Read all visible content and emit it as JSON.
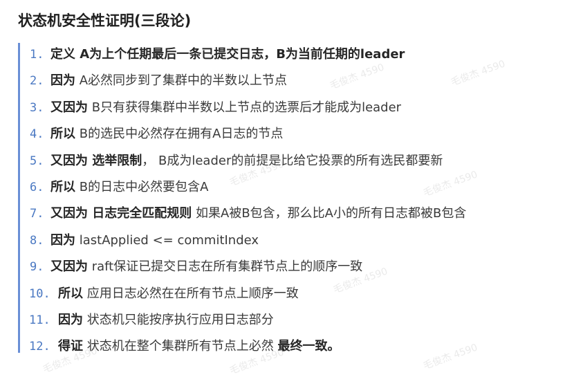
{
  "heading": "状态机安全性证明(三段论)",
  "watermark_text": "毛俊杰 4590",
  "items": [
    {
      "num": "1.",
      "kw": "定义",
      "segments": [
        {
          "t": " A为上个任期最后一条已提交日志，B为当前任期的leader",
          "b": true
        }
      ]
    },
    {
      "num": "2.",
      "kw": "因为",
      "segments": [
        {
          "t": " A必然同步到了集群中的半数以上节点",
          "b": false
        }
      ]
    },
    {
      "num": "3.",
      "kw": "又因为",
      "segments": [
        {
          "t": " B只有获得集群中半数以上节点的选票后才能成为leader",
          "b": false
        }
      ]
    },
    {
      "num": "4.",
      "kw": "所以",
      "segments": [
        {
          "t": " B的选民中必然存在拥有A日志的节点",
          "b": false
        }
      ]
    },
    {
      "num": "5.",
      "kw": "又因为",
      "segments": [
        {
          "t": " 选举限制",
          "b": true
        },
        {
          "t": "， B成为leader的前提是比给它投票的所有选民都要新",
          "b": false
        }
      ]
    },
    {
      "num": "6.",
      "kw": "所以",
      "segments": [
        {
          "t": " B的日志中必然要包含A",
          "b": false
        }
      ]
    },
    {
      "num": "7.",
      "kw": "又因为",
      "segments": [
        {
          "t": " 日志完全匹配规则",
          "b": true
        },
        {
          "t": " 如果A被B包含，那么比A小的所有日志都被B包含",
          "b": false
        }
      ]
    },
    {
      "num": "8.",
      "kw": "因为",
      "segments": [
        {
          "t": " lastApplied <= commitIndex",
          "b": false
        }
      ]
    },
    {
      "num": "9.",
      "kw": "又因为",
      "segments": [
        {
          "t": " raft保证已提交日志在所有集群节点上的顺序一致",
          "b": false
        }
      ]
    },
    {
      "num": "10.",
      "kw": "所以",
      "segments": [
        {
          "t": " 应用日志必然在在所有节点上顺序一致",
          "b": false
        }
      ]
    },
    {
      "num": "11.",
      "kw": "因为",
      "segments": [
        {
          "t": " 状态机只能按序执行应用日志部分",
          "b": false
        }
      ]
    },
    {
      "num": "12.",
      "kw": "得证",
      "segments": [
        {
          "t": " 状态机在整个集群所有节点上必然 ",
          "b": false
        },
        {
          "t": "最终一致。",
          "b": true
        }
      ]
    }
  ]
}
